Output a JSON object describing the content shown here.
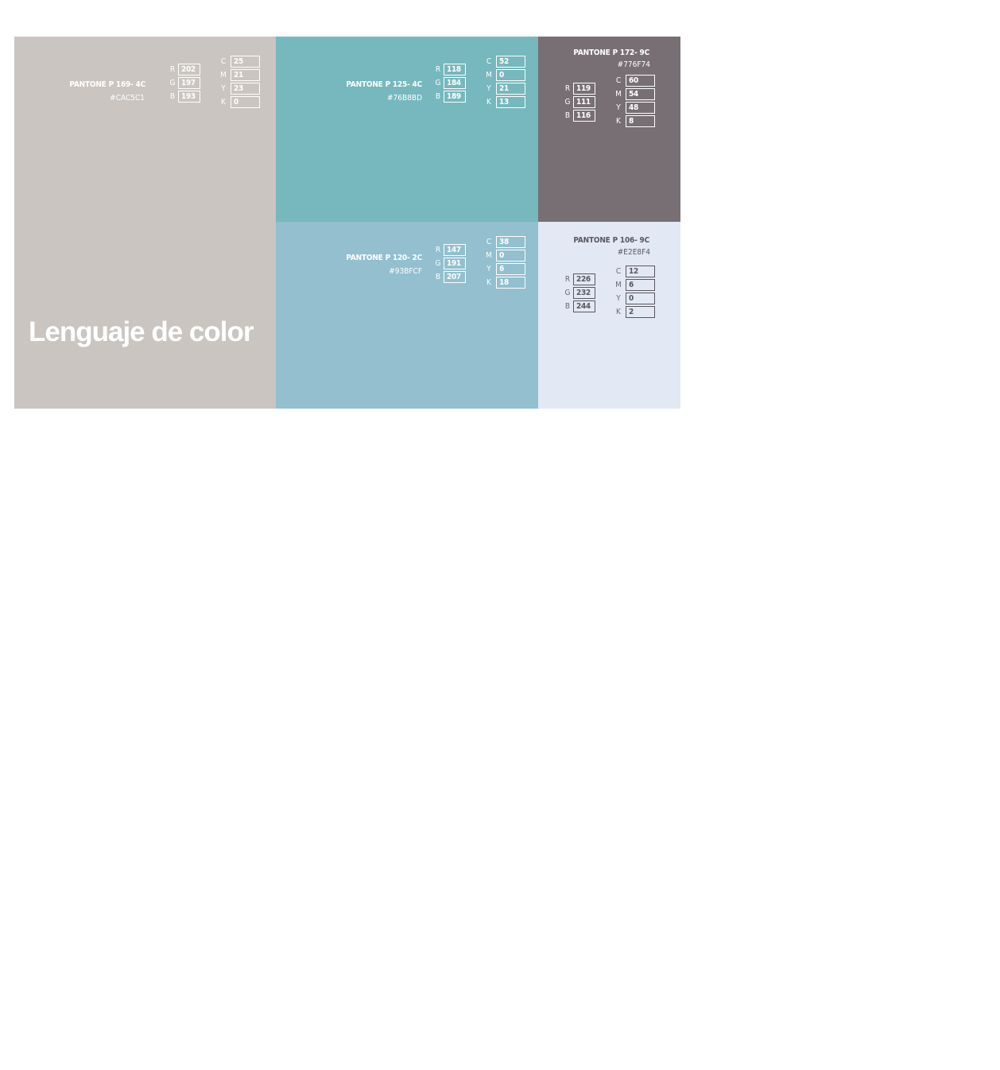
{
  "page_title": "Lenguaje de color",
  "swatches": [
    {
      "id": "p169",
      "pantone": "PANTONE P 169- 4C",
      "hex": "#CAC5C1",
      "color": "#cac5c1",
      "rgb": {
        "r": "202",
        "g": "197",
        "b": "193"
      },
      "cmyk": {
        "c": "25",
        "m": "21",
        "y": "23",
        "k": "0"
      }
    },
    {
      "id": "p125",
      "pantone": "PANTONE P 125- 4C",
      "hex": "#76B8BD",
      "color": "#76b8bd",
      "rgb": {
        "r": "118",
        "g": "184",
        "b": "189"
      },
      "cmyk": {
        "c": "52",
        "m": "0",
        "y": "21",
        "k": "13"
      }
    },
    {
      "id": "p172",
      "pantone": "PANTONE P 172- 9C",
      "hex": "#776F74",
      "color": "#776f74",
      "rgb": {
        "r": "119",
        "g": "111",
        "b": "116"
      },
      "cmyk": {
        "c": "60",
        "m": "54",
        "y": "48",
        "k": "8"
      }
    },
    {
      "id": "p120",
      "pantone": "PANTONE P 120- 2C",
      "hex": "#93BFCF",
      "color": "#93bfcf",
      "rgb": {
        "r": "147",
        "g": "191",
        "b": "207"
      },
      "cmyk": {
        "c": "38",
        "m": "0",
        "y": "6",
        "k": "18"
      }
    },
    {
      "id": "p106",
      "pantone": "PANTONE P 106- 9C",
      "hex": "#E2E8F4",
      "color": "#e2e8f4",
      "rgb": {
        "r": "226",
        "g": "232",
        "b": "244"
      },
      "cmyk": {
        "c": "12",
        "m": "6",
        "y": "0",
        "k": "2"
      }
    }
  ],
  "labels": {
    "r": "R",
    "g": "G",
    "b": "B",
    "c": "C",
    "m": "M",
    "y": "Y",
    "k": "K"
  }
}
